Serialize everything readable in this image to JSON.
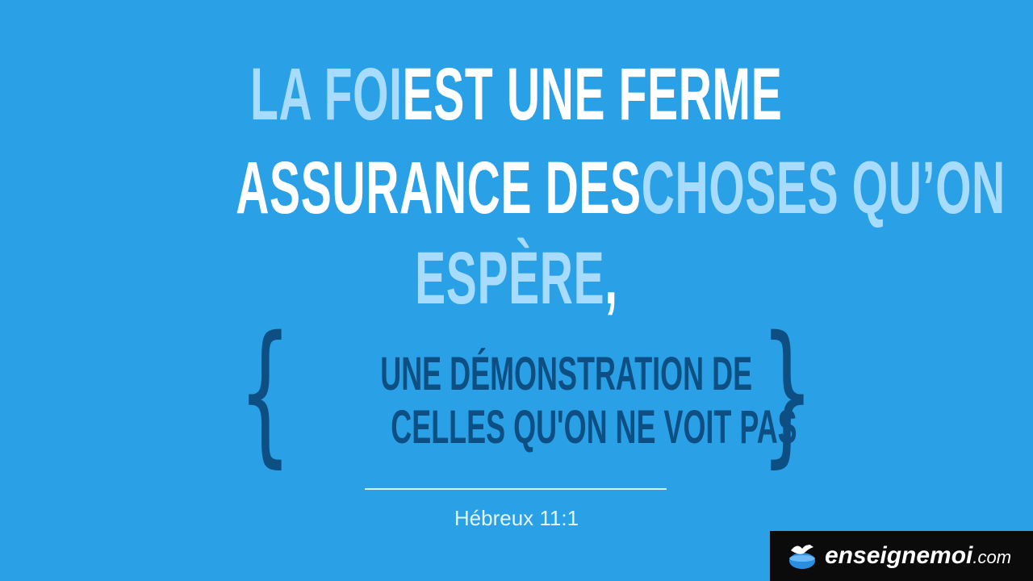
{
  "verse": {
    "line1": [
      {
        "text": "LA FOI ",
        "highlight": true
      },
      {
        "text": "EST UNE FERME",
        "highlight": false
      }
    ],
    "line2": [
      {
        "text": "ASSURANCE DES ",
        "highlight": false
      },
      {
        "text": "CHOSES QU’ON",
        "highlight": true
      }
    ],
    "line3": [
      {
        "text": "ESPÈRE",
        "highlight": true
      },
      {
        "text": ",",
        "highlight": false
      }
    ],
    "subline1": "UNE DÉMONSTRATION DE",
    "subline2": "CELLES QU'ON NE VOIT PAS",
    "brace_open": "{",
    "brace_close": "}",
    "reference": "Hébreux 11:1"
  },
  "logo": {
    "name": "enseignemoi",
    "domain": ".com",
    "icon": "globe-dove-icon"
  },
  "colors": {
    "background": "#2aa1e6",
    "highlight_text": "#a8dcff",
    "main_text": "#ffffff",
    "subtext": "#0d4f82",
    "logo_bg": "#0b0b0b"
  }
}
